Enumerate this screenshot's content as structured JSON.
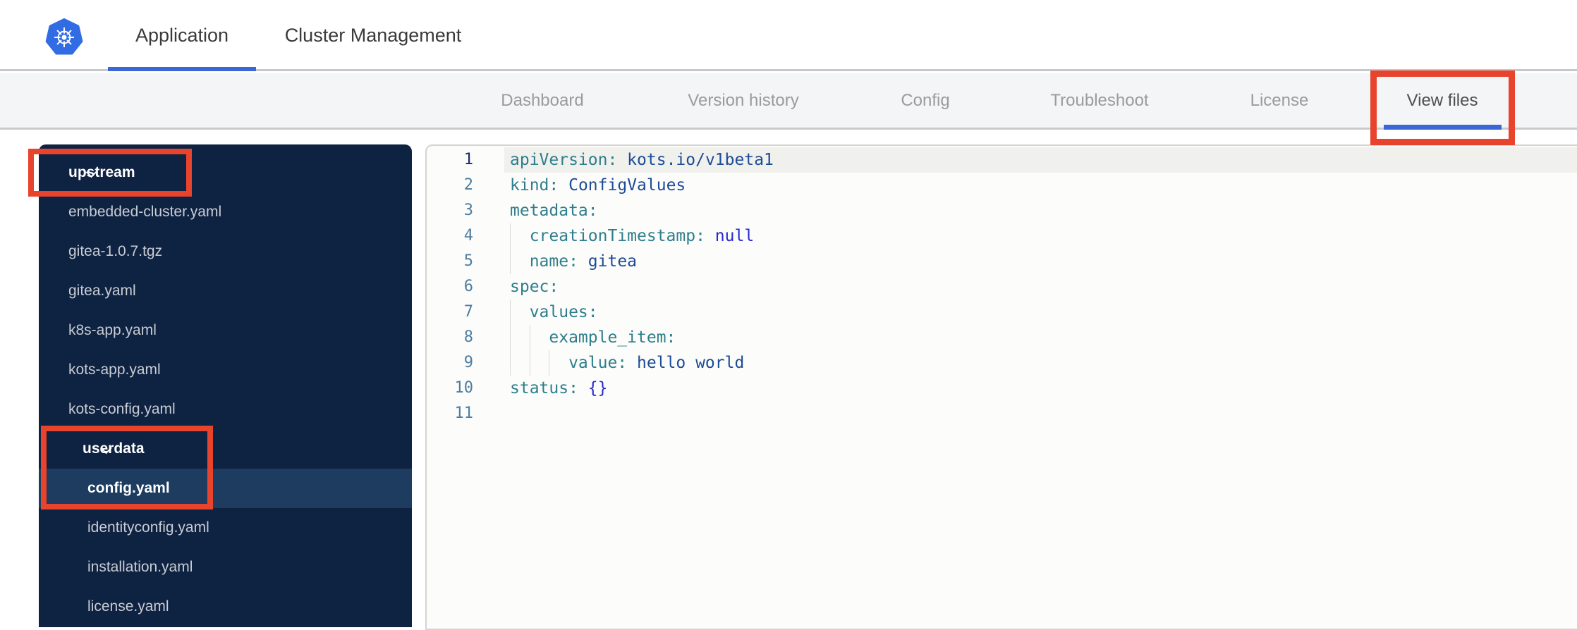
{
  "brand": {
    "logo_icon": "kubernetes-logo"
  },
  "top_nav": {
    "tabs": [
      {
        "label": "Application",
        "active": true
      },
      {
        "label": "Cluster Management",
        "active": false
      }
    ]
  },
  "app_nav": {
    "tabs": [
      {
        "label": "Dashboard",
        "active": false
      },
      {
        "label": "Version history",
        "active": false
      },
      {
        "label": "Config",
        "active": false
      },
      {
        "label": "Troubleshoot",
        "active": false
      },
      {
        "label": "License",
        "active": false
      },
      {
        "label": "View files",
        "active": true
      }
    ]
  },
  "file_tree": {
    "items": [
      {
        "label": "upstream",
        "kind": "folder",
        "depth": 0,
        "expanded": true,
        "selected": false
      },
      {
        "label": "embedded-cluster.yaml",
        "kind": "file",
        "depth": 0,
        "selected": false
      },
      {
        "label": "gitea-1.0.7.tgz",
        "kind": "file",
        "depth": 0,
        "selected": false
      },
      {
        "label": "gitea.yaml",
        "kind": "file",
        "depth": 0,
        "selected": false
      },
      {
        "label": "k8s-app.yaml",
        "kind": "file",
        "depth": 0,
        "selected": false
      },
      {
        "label": "kots-app.yaml",
        "kind": "file",
        "depth": 0,
        "selected": false
      },
      {
        "label": "kots-config.yaml",
        "kind": "file",
        "depth": 0,
        "selected": false
      },
      {
        "label": "userdata",
        "kind": "folder",
        "depth": 1,
        "expanded": true,
        "selected": false
      },
      {
        "label": "config.yaml",
        "kind": "file",
        "depth": 1,
        "selected": true
      },
      {
        "label": "identityconfig.yaml",
        "kind": "file",
        "depth": 1,
        "selected": false
      },
      {
        "label": "installation.yaml",
        "kind": "file",
        "depth": 1,
        "selected": false
      },
      {
        "label": "license.yaml",
        "kind": "file",
        "depth": 1,
        "selected": false
      }
    ]
  },
  "editor": {
    "language": "yaml",
    "lines": [
      {
        "number": 1,
        "indent": 0,
        "active": true,
        "segments": [
          {
            "text": "apiVersion:",
            "token": "key"
          },
          {
            "text": " kots.io/v1beta1",
            "token": "value"
          }
        ]
      },
      {
        "number": 2,
        "indent": 0,
        "active": false,
        "segments": [
          {
            "text": "kind:",
            "token": "key"
          },
          {
            "text": " ConfigValues",
            "token": "value"
          }
        ]
      },
      {
        "number": 3,
        "indent": 0,
        "active": false,
        "segments": [
          {
            "text": "metadata:",
            "token": "key"
          }
        ]
      },
      {
        "number": 4,
        "indent": 1,
        "active": false,
        "segments": [
          {
            "text": "creationTimestamp:",
            "token": "key"
          },
          {
            "text": " ",
            "token": "plain"
          },
          {
            "text": "null",
            "token": "literal"
          }
        ]
      },
      {
        "number": 5,
        "indent": 1,
        "active": false,
        "segments": [
          {
            "text": "name:",
            "token": "key"
          },
          {
            "text": " gitea",
            "token": "value"
          }
        ]
      },
      {
        "number": 6,
        "indent": 0,
        "active": false,
        "segments": [
          {
            "text": "spec:",
            "token": "key"
          }
        ]
      },
      {
        "number": 7,
        "indent": 1,
        "active": false,
        "segments": [
          {
            "text": "values:",
            "token": "key"
          }
        ]
      },
      {
        "number": 8,
        "indent": 2,
        "active": false,
        "segments": [
          {
            "text": "example_item:",
            "token": "key"
          }
        ]
      },
      {
        "number": 9,
        "indent": 3,
        "active": false,
        "segments": [
          {
            "text": "value:",
            "token": "key"
          },
          {
            "text": " hello world",
            "token": "value"
          }
        ]
      },
      {
        "number": 10,
        "indent": 0,
        "active": false,
        "segments": [
          {
            "text": "status:",
            "token": "key"
          },
          {
            "text": " ",
            "token": "plain"
          },
          {
            "text": "{}",
            "token": "literal"
          }
        ]
      },
      {
        "number": 11,
        "indent": 0,
        "active": false,
        "segments": []
      }
    ]
  },
  "annotations": {
    "color": "#e8432c",
    "boxes": [
      "view-files-tab",
      "upstream-folder",
      "userdata-folder-and-config-yaml"
    ]
  },
  "colors": {
    "accent_blue": "#3a66d6",
    "kubernetes_blue": "#326ce5",
    "sidebar_bg": "#0e2242",
    "sidebar_selected_bg": "#1d3c5f",
    "annotation_red": "#e8432c",
    "token_key": "#2e7e8c",
    "token_value": "#1d4c97",
    "token_literal": "#2a2ad2",
    "token_plain": "#333333",
    "line_number": "#4d7ea1",
    "line_number_active": "#1b2c66"
  }
}
